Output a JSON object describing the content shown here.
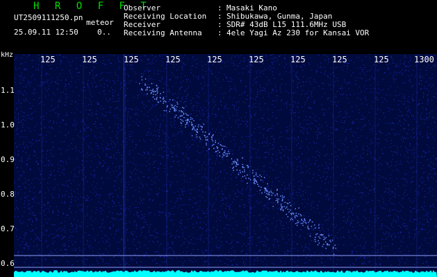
{
  "header": {
    "title": "H R O F F T",
    "file_name": "UT2509111250.pn",
    "event_type": "meteor",
    "date_time": "25.09.11 12:50",
    "count": "0..",
    "info": [
      {
        "label": "Observer",
        "value": "Masaki Kano"
      },
      {
        "label": "Receiving Location",
        "value": "Shibukawa, Gunma, Japan"
      },
      {
        "label": "Receiver",
        "value": "SDR# 43dB L15 111.6MHz USB"
      },
      {
        "label": "Receiving Antenna",
        "value": "4ele Yagi Az 230 for Kansai VOR"
      }
    ]
  },
  "axes": {
    "y_unit": "kHz",
    "y_ticks": [
      "1.1",
      "1.0",
      "0.9",
      "0.8",
      "0.7",
      "0.6"
    ],
    "x_ticks": [
      "125",
      "125",
      "125",
      "125",
      "125",
      "125",
      "125",
      "125",
      "125",
      "1300"
    ]
  },
  "colors": {
    "background": "#000000",
    "spectrum_base": "#000a3c",
    "noise_dot": "#2a3cff",
    "trace": "#6a8cff",
    "baseline": "#00ffff",
    "title_green": "#00e000"
  }
}
